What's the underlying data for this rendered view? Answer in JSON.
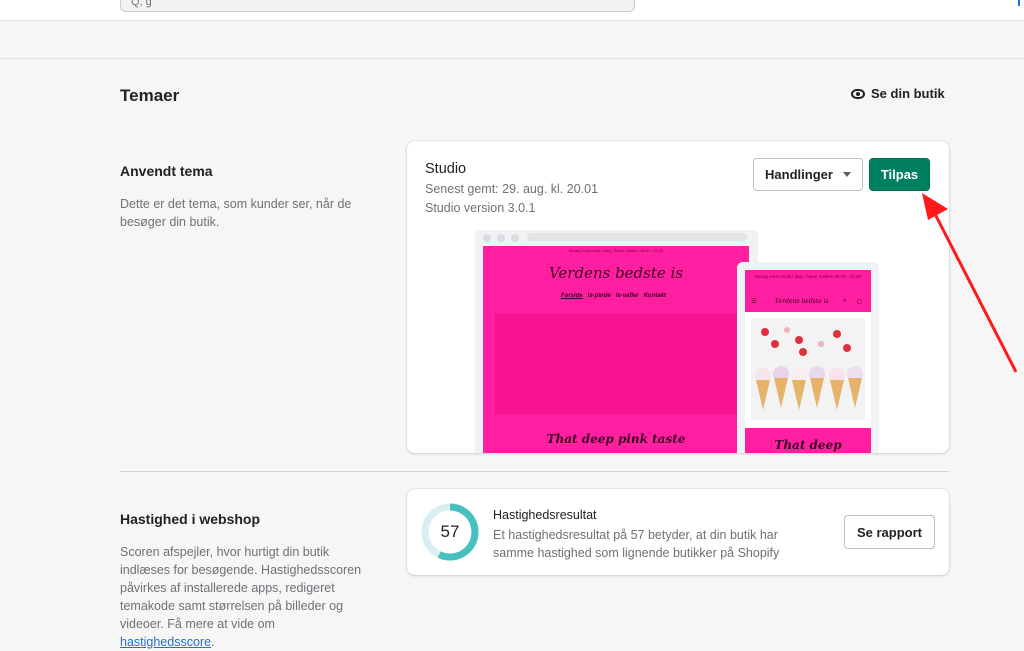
{
  "search": {
    "placeholder": "",
    "visible_text": "Q, g"
  },
  "header": {
    "title": "Temaer",
    "view_store_label": "Se din butik"
  },
  "current_theme": {
    "section_title": "Anvendt tema",
    "section_desc": "Dette er det tema, som kunder ser, når de besøger din butik.",
    "name": "Studio",
    "saved": "Senest gemt: 29. aug. kl. 20.01",
    "version": "Studio version 3.0.1",
    "actions_label": "Handlinger",
    "customize_label": "Tilpas",
    "preview": {
      "desktop_logo": "Verdens bedste is",
      "desktop_nav": [
        "Forside",
        "Is-pinde",
        "Is-vafler",
        "Kontakt"
      ],
      "desktop_tagline": "That deep pink taste",
      "mobile_announcement": "Besøg vores butik i dag | Åbent mellem 08.00 - 22.00",
      "mobile_logo": "Verdens bedste is",
      "mobile_tagline": "That deep",
      "brand_color": "#ff1fa0"
    }
  },
  "speed": {
    "section_title": "Hastighed i webshop",
    "section_desc_text": "Scoren afspejler, hvor hurtigt din butik indlæses for besøgende. Hastighedsscoren påvirkes af installerede apps, redigeret temakode samt størrelsen på billeder og videoer. Få mere at vide om ",
    "section_desc_link": "hastighedsscore",
    "section_desc_end": ".",
    "score": "57",
    "score_fraction": 0.57,
    "result_title": "Hastighedsresultat",
    "result_desc": "Et hastighedsresultat på 57 betyder, at din butik har samme hastighed som lignende butikker på Shopify",
    "report_label": "Se rapport",
    "ring_color": "#47c1bf"
  },
  "colors": {
    "primary_button": "#008060",
    "arrow": "#ff1a1a"
  }
}
